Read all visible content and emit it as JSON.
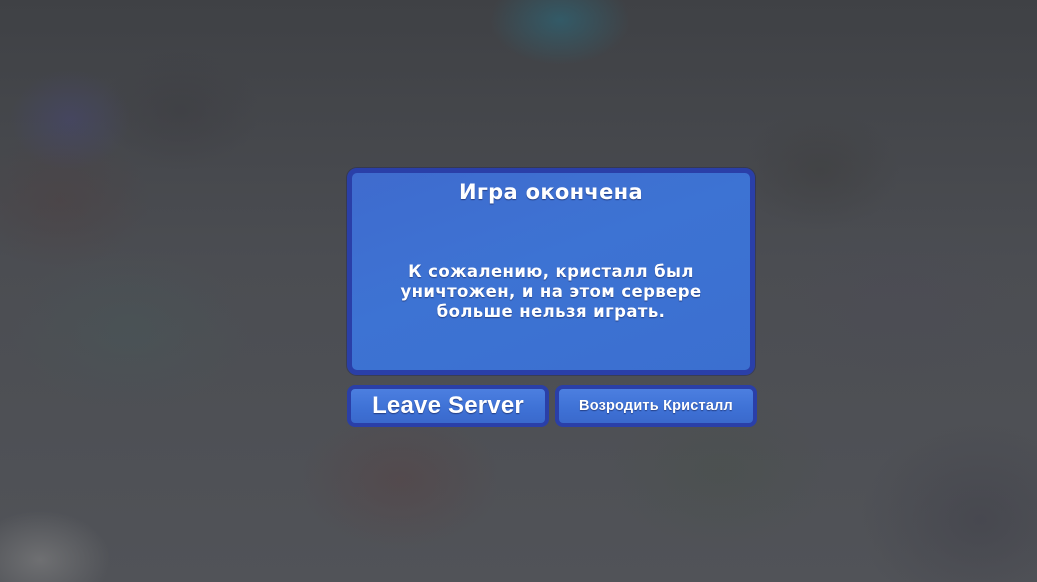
{
  "dialog": {
    "title": "Игра окончена",
    "message": "К сожалению, кристалл был уничтожен, и на этом сервере больше нельзя играть."
  },
  "buttons": {
    "leave_label": "Leave Server",
    "revive_label": "Возродить Кристалл"
  },
  "colors": {
    "panel_fill": "#3d73d3",
    "panel_border": "#2a3fa8",
    "text": "#ffffff",
    "backdrop": "#4b4d52"
  }
}
